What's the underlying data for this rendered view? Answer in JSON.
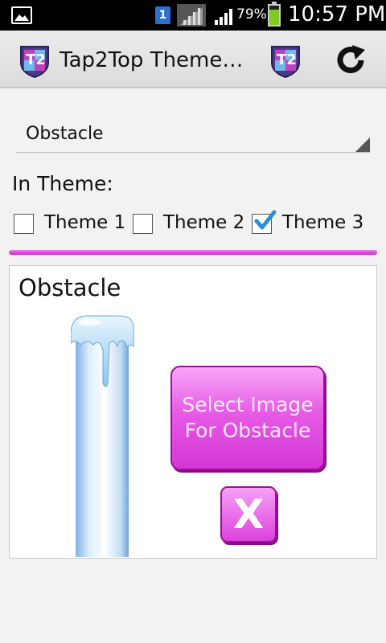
{
  "status_bar": {
    "sim_slot": "1",
    "battery_percent": "79%",
    "battery_level": 0.79,
    "time": "10:57 PM"
  },
  "action_bar": {
    "title": "Tap2Top Theme…",
    "icons": [
      "app-logo-icon",
      "share-logo-icon",
      "refresh-icon"
    ]
  },
  "spinner": {
    "selected": "Obstacle"
  },
  "in_theme": {
    "label": "In Theme:",
    "themes": [
      {
        "label": "Theme 1",
        "checked": false
      },
      {
        "label": "Theme 2",
        "checked": false
      },
      {
        "label": "Theme 3",
        "checked": true
      }
    ]
  },
  "card": {
    "title": "Obstacle",
    "select_button": "Select Image For Obstacle",
    "close_button": "X"
  },
  "colors": {
    "accent": "#d436d4",
    "status_bar": "#000000",
    "check": "#2a8fd6"
  }
}
